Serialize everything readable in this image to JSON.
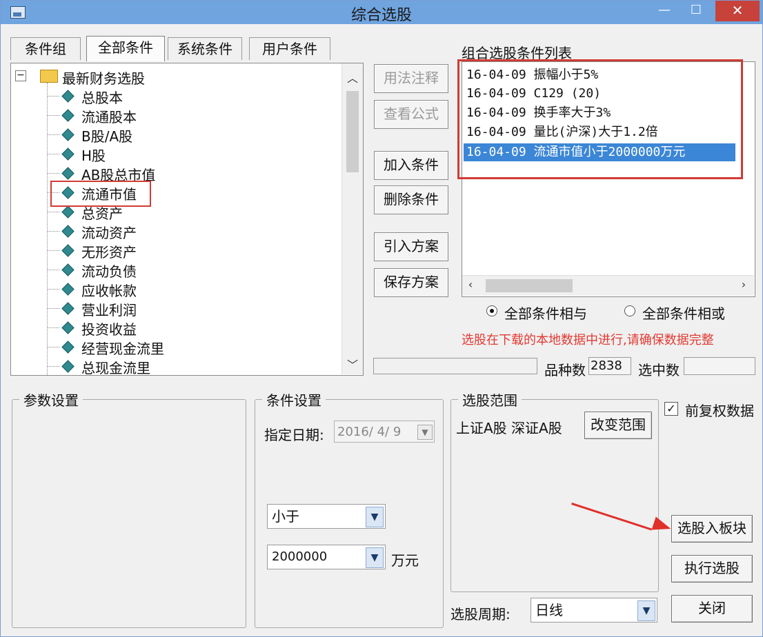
{
  "window": {
    "title": "综合选股",
    "controls": {
      "minimize": "—",
      "maximize": "☐",
      "close": "✕"
    }
  },
  "tabs": [
    "条件组",
    "全部条件",
    "系统条件",
    "用户条件"
  ],
  "tree": {
    "root_label": "最新财务选股",
    "root_expander": "−",
    "items": [
      "总股本",
      "流通股本",
      "B股/A股",
      "H股",
      "AB股总市值",
      "流通市值",
      "总资产",
      "流动资产",
      "无形资产",
      "流动负债",
      "应收帐款",
      "营业利润",
      "投资收益",
      "经营现金流里",
      "总现金流里"
    ],
    "highlighted_item": "流通市值"
  },
  "middle_buttons": {
    "usage_note": "用法注释",
    "view_formula": "查看公式",
    "add_condition": "加入条件",
    "delete_condition": "删除条件",
    "import_plan": "引入方案",
    "save_plan": "保存方案"
  },
  "condition_list": {
    "label": "组合选股条件列表",
    "rows": [
      "16-04-09 振幅小于5%",
      "16-04-09 C129 (20)",
      "16-04-09 换手率大于3%",
      "16-04-09 量比(沪深)大于1.2倍",
      "16-04-09 流通市值小于2000000万元"
    ],
    "selected_index": 4
  },
  "logic": {
    "and_label": "全部条件相与",
    "or_label": "全部条件相或",
    "selected": "and"
  },
  "warning": "选股在下载的本地数据中进行,请确保数据完整",
  "stats": {
    "variety_label": "品种数",
    "variety_value": "2838",
    "selected_label": "选中数",
    "selected_value": ""
  },
  "param_group": {
    "title": "参数设置"
  },
  "condition_settings": {
    "title": "条件设置",
    "date_label": "指定日期:",
    "date_value": "2016/ 4/ 9",
    "operator_value": "小于",
    "amount_value": "2000000",
    "amount_unit": "万元"
  },
  "range_group": {
    "title": "选股范围",
    "markets": "上证A股  深证A股",
    "change_button": "改变范围"
  },
  "period": {
    "label": "选股周期:",
    "value": "日线"
  },
  "right_panel": {
    "adjusted_label": "前复权数据",
    "adjusted_checked": true,
    "to_block_button": "选股入板块",
    "execute_button": "执行选股",
    "close_button": "关闭"
  },
  "colors": {
    "titlebar": "#6fa4df",
    "highlight_red": "#d23a33",
    "selection_blue": "#3b86d6",
    "warning_red": "#e33a32"
  }
}
